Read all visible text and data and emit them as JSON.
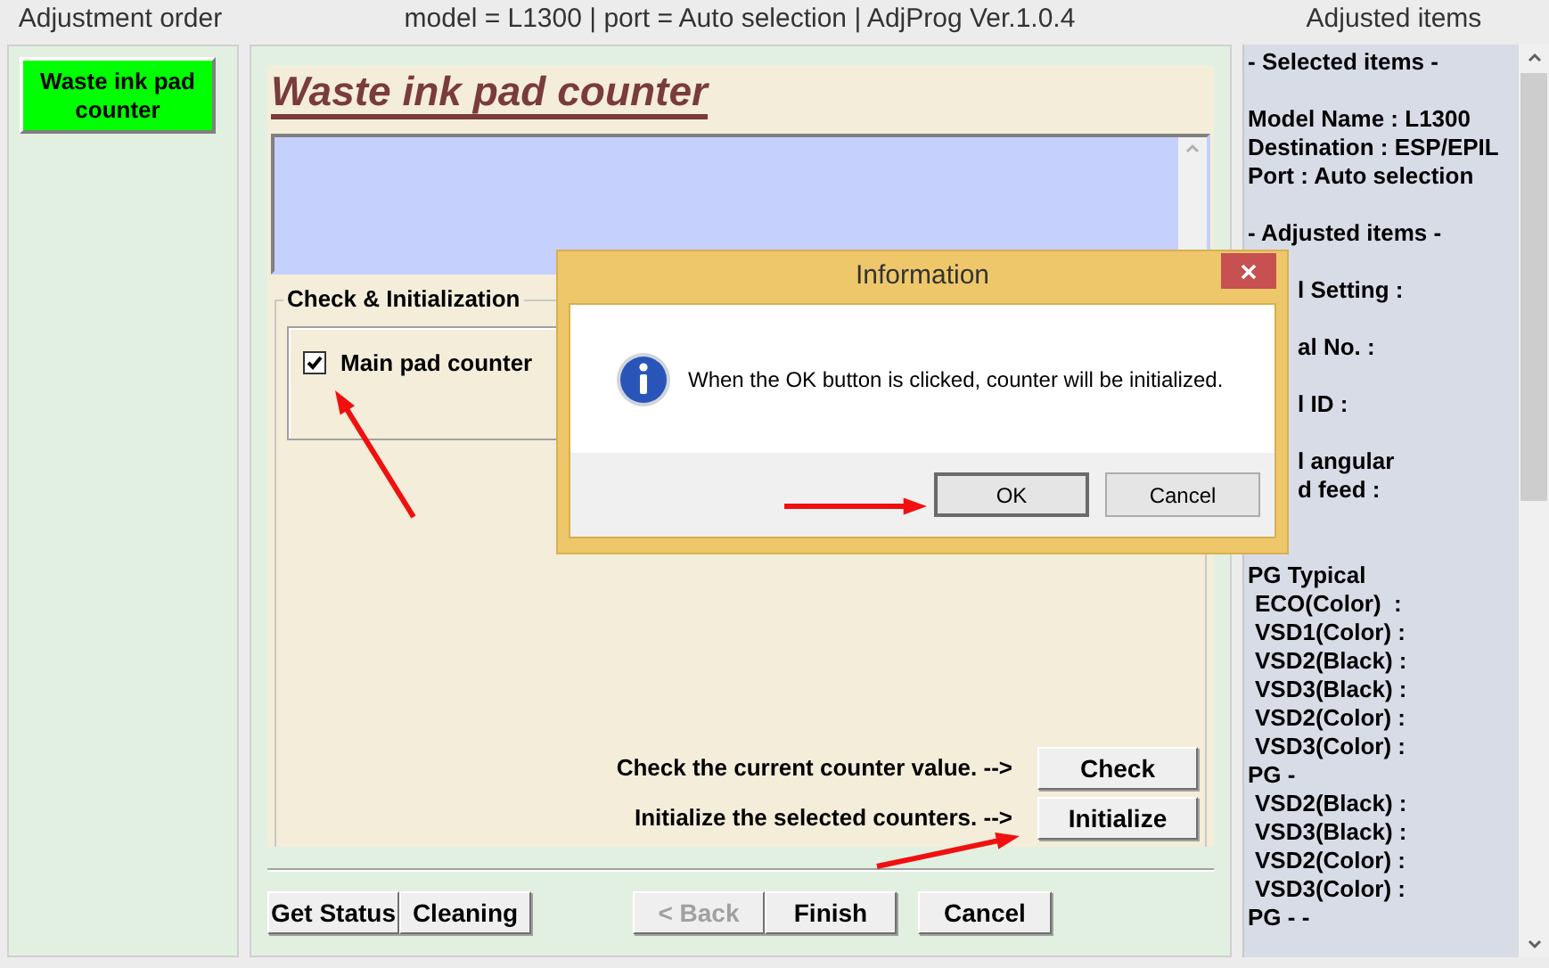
{
  "window": {
    "title": "model = L1300 | port = Auto selection | AdjProg Ver.1.0.4"
  },
  "left_panel": {
    "header": "Adjustment order",
    "items": [
      {
        "label": "Waste ink pad counter",
        "selected": true
      }
    ]
  },
  "main": {
    "heading": "Waste ink pad counter",
    "group": {
      "title": "Check & Initialization",
      "counters": [
        {
          "label": "Main pad counter",
          "checked": true
        }
      ]
    },
    "actions": [
      {
        "text": "Check the current counter value. -->",
        "button": "Check"
      },
      {
        "text": "Initialize the selected counters. -->",
        "button": "Initialize"
      }
    ],
    "footer_buttons": [
      {
        "label": "Get Status",
        "disabled": false,
        "kind": "left"
      },
      {
        "label": "Cleaning",
        "disabled": false,
        "kind": "left"
      },
      {
        "label": "< Back",
        "disabled": true,
        "kind": "nav"
      },
      {
        "label": "Finish",
        "disabled": false,
        "kind": "nav"
      },
      {
        "label": "Cancel",
        "disabled": false,
        "kind": "cancel"
      }
    ]
  },
  "right_panel": {
    "header": "Adjusted items",
    "lines": [
      {
        "kind": "line",
        "text": "- Selected items -"
      },
      {
        "kind": "gap"
      },
      {
        "kind": "line",
        "text": "Model Name : L1300"
      },
      {
        "kind": "line",
        "text": "Destination : ESP/EPIL"
      },
      {
        "kind": "line",
        "text": "Port : Auto selection"
      },
      {
        "kind": "gap"
      },
      {
        "kind": "line",
        "text": "- Adjusted items -"
      },
      {
        "kind": "gap"
      },
      {
        "kind": "clipped",
        "text": "l Setting :"
      },
      {
        "kind": "gap"
      },
      {
        "kind": "clipped",
        "text": "al No. :"
      },
      {
        "kind": "gap"
      },
      {
        "kind": "clipped",
        "text": "l ID :"
      },
      {
        "kind": "gap"
      },
      {
        "kind": "clipped",
        "text": "l angular"
      },
      {
        "kind": "clipped",
        "text": "d feed :"
      },
      {
        "kind": "gap"
      },
      {
        "kind": "gap"
      },
      {
        "kind": "line",
        "text": "PG Typical"
      },
      {
        "kind": "sub",
        "text": "ECO(Color)  :"
      },
      {
        "kind": "sub",
        "text": "VSD1(Color) :"
      },
      {
        "kind": "sub",
        "text": "VSD2(Black) :"
      },
      {
        "kind": "sub",
        "text": "VSD3(Black) :"
      },
      {
        "kind": "sub",
        "text": "VSD2(Color) :"
      },
      {
        "kind": "sub",
        "text": "VSD3(Color) :"
      },
      {
        "kind": "line",
        "text": "PG -"
      },
      {
        "kind": "sub",
        "text": "VSD2(Black) :"
      },
      {
        "kind": "sub",
        "text": "VSD3(Black) :"
      },
      {
        "kind": "sub",
        "text": "VSD2(Color) :"
      },
      {
        "kind": "sub",
        "text": "VSD3(Color) :"
      },
      {
        "kind": "line",
        "text": "PG - -"
      }
    ]
  },
  "dialog": {
    "title": "Information",
    "message": "When the OK button is clicked, counter will be initialized.",
    "buttons": [
      {
        "label": "OK",
        "selected": true
      },
      {
        "label": "Cancel",
        "selected": false
      }
    ]
  }
}
